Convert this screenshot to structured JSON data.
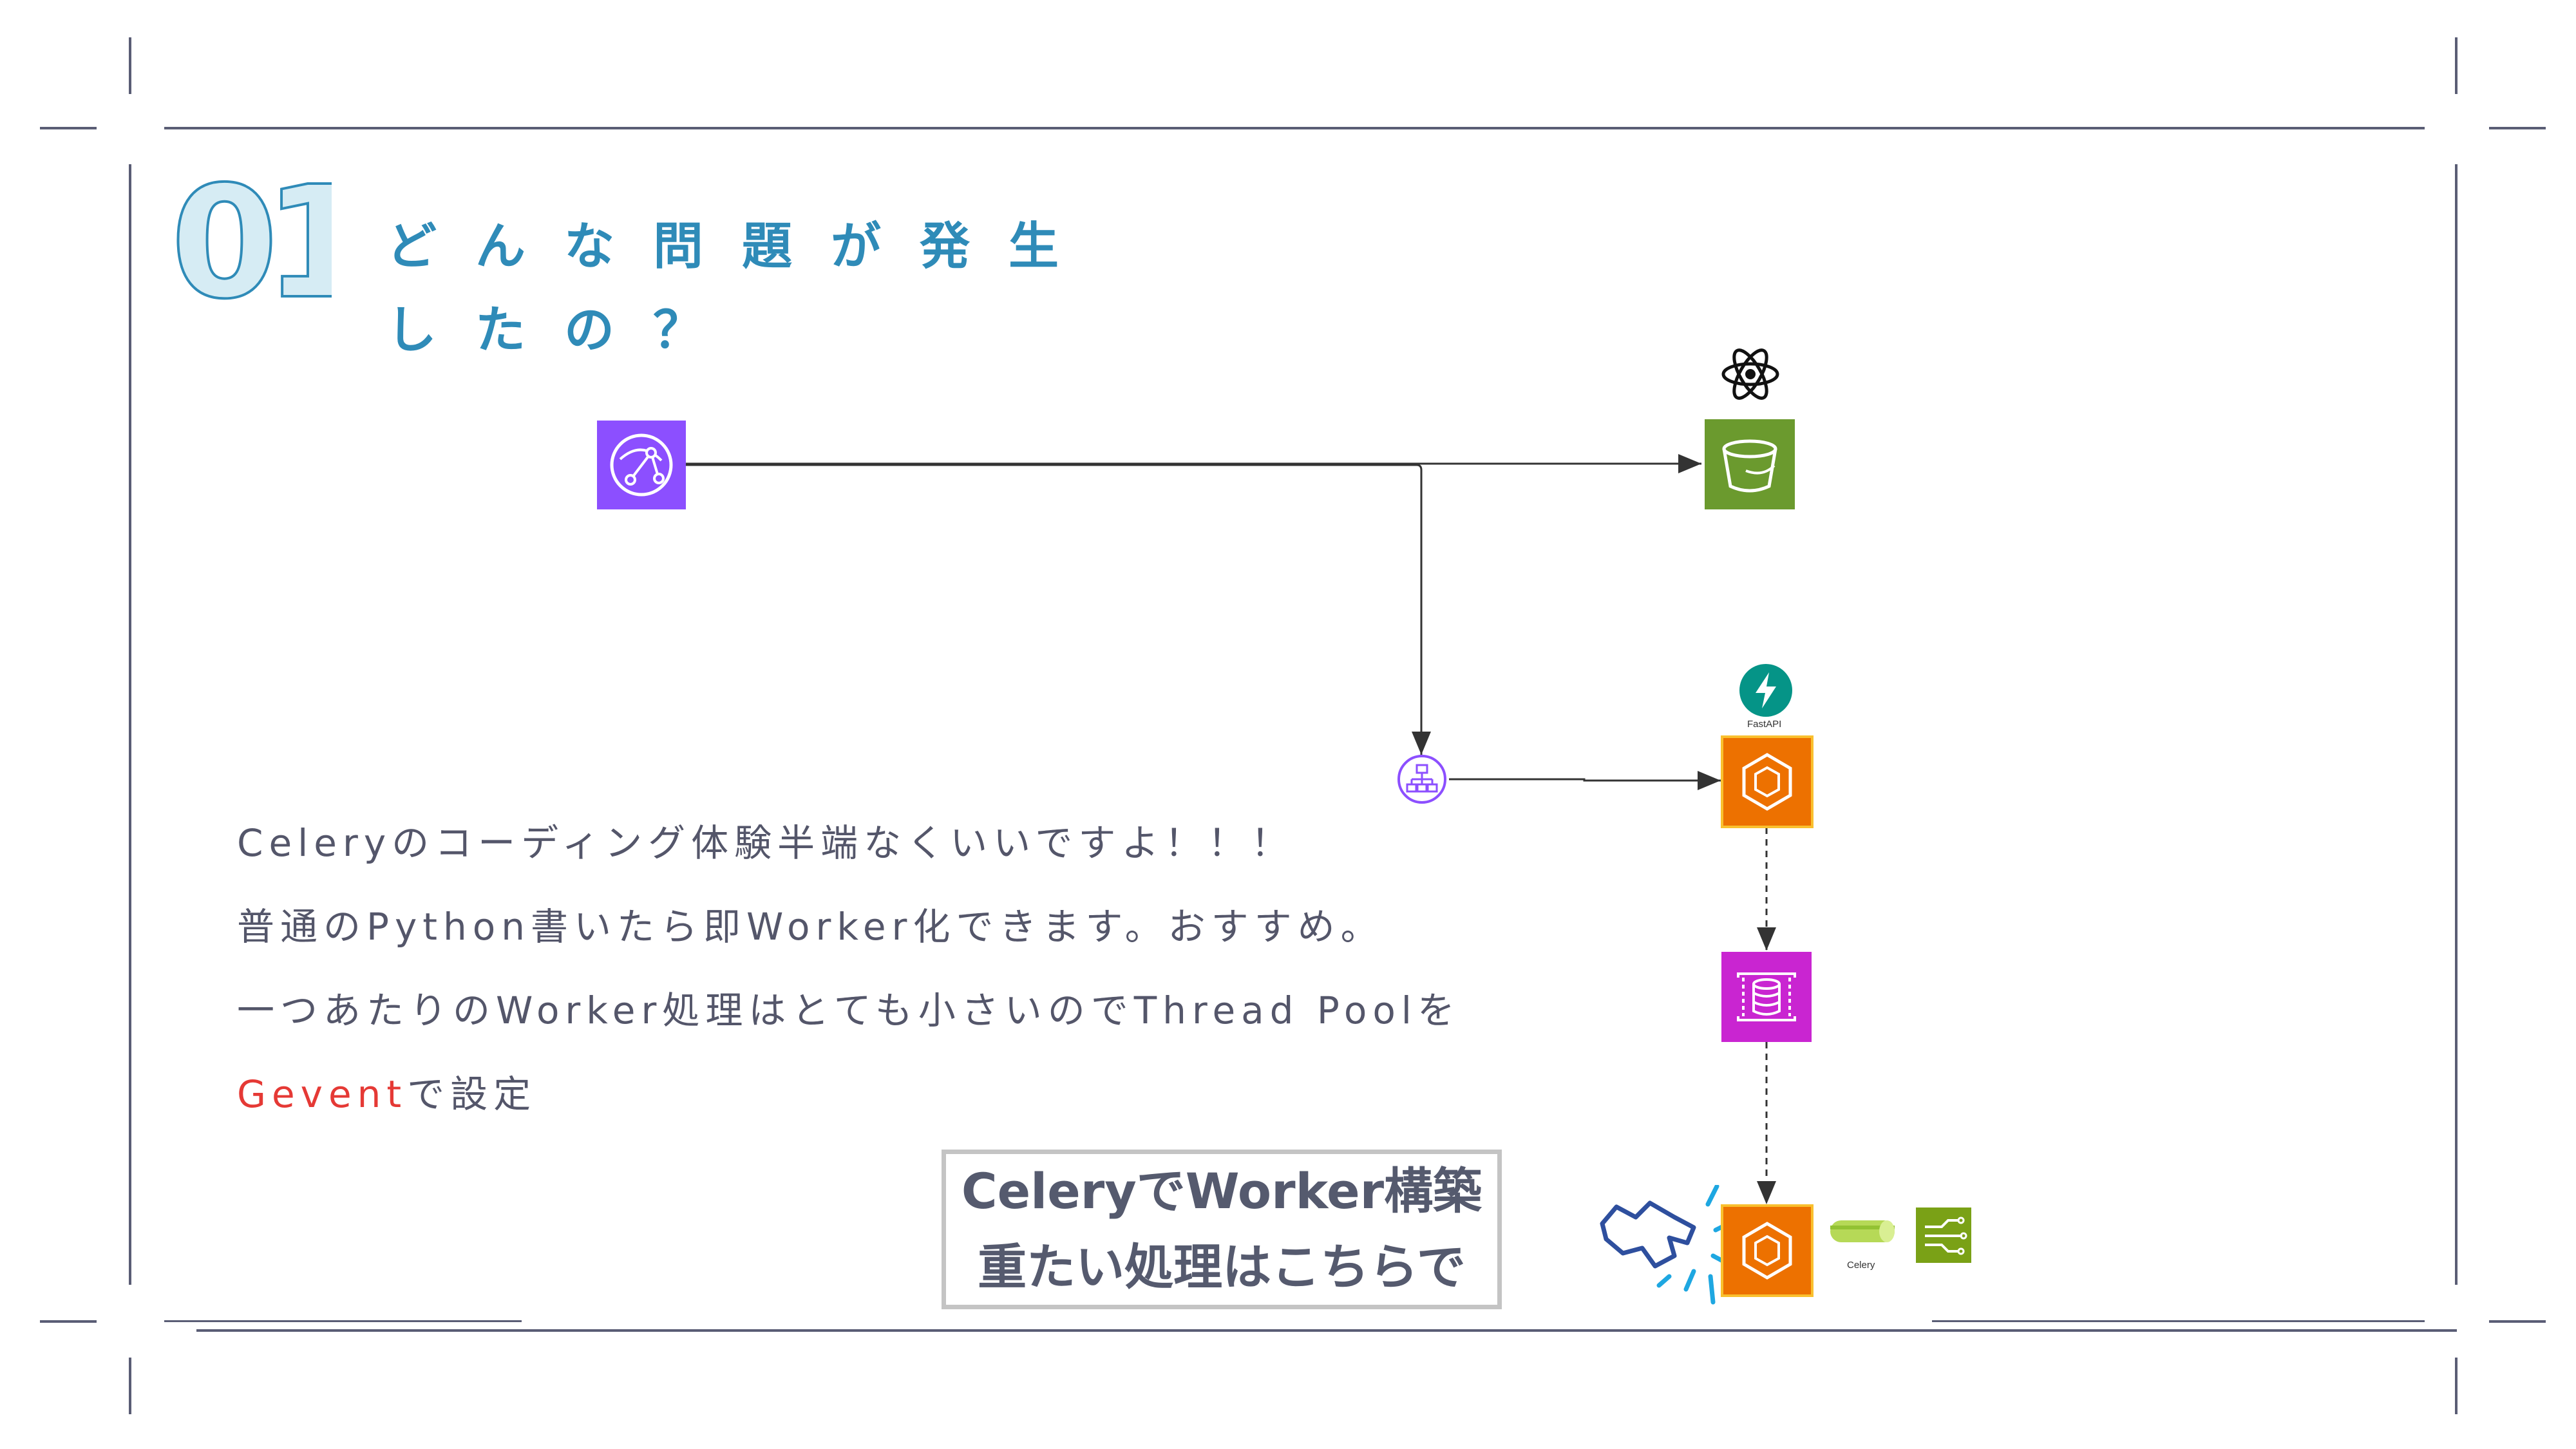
{
  "slide": {
    "number": "01",
    "title_line1": "どんな問題が発生",
    "title_line2": "したの？"
  },
  "body": {
    "line1": "Celeryのコーディング体験半端なくいいですよ！！！",
    "line2": "普通のPython書いたら即Worker化できます。おすすめ。",
    "line3": "一つあたりのWorker処理はとても小さいのでThread Poolを",
    "line4_accent": "Gevent",
    "line4_rest": "で設定"
  },
  "callout": {
    "line1": "CeleryでWorker構築",
    "line2": "重たい処理はこちらで"
  },
  "diagram": {
    "fastapi_label": "FastAPI",
    "celery_label": "Celery",
    "colors": {
      "cloudfront": "#8c4fff",
      "s3": "#6b9a2e",
      "ecs": "#ed7100",
      "sqs": "#c925d1",
      "fastapi": "#059487",
      "eventbridge": "#7aa116",
      "lines": "#333333",
      "accent": "#2f8bb8"
    },
    "icons": [
      "cloudfront-icon",
      "react-icon",
      "s3-bucket-icon",
      "load-balancer-icon",
      "fastapi-icon",
      "ecs-container-icon",
      "queue-icon",
      "celery-icon",
      "circuit-icon"
    ]
  }
}
